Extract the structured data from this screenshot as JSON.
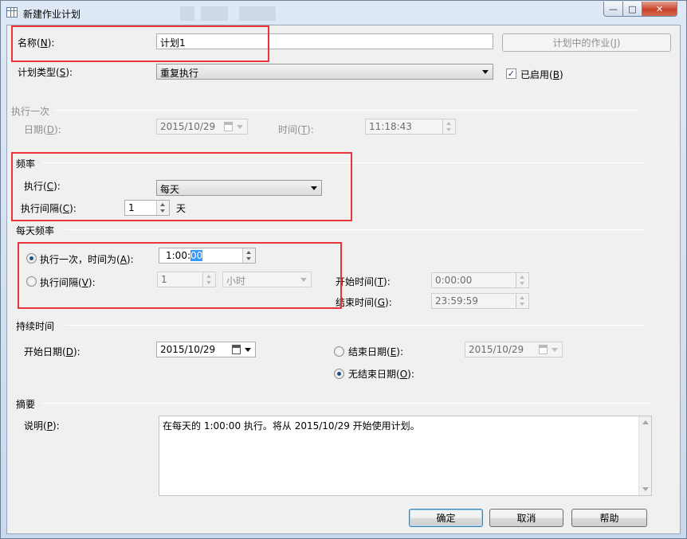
{
  "window": {
    "title": "新建作业计划"
  },
  "name_row": {
    "label": "名称",
    "accel": "N",
    "value": "计划1",
    "jobs_button": "计划中的作业",
    "jobs_accel": "J"
  },
  "type_row": {
    "label": "计划类型",
    "accel": "S",
    "value": "重复执行",
    "enabled_label": "已启用",
    "enabled_accel": "B",
    "enabled_checked": true
  },
  "once": {
    "section": "执行一次",
    "date_label": "日期",
    "date_accel": "D",
    "date_value": "2015/10/29",
    "time_label": "时间",
    "time_accel": "T",
    "time_value": "11:18:43"
  },
  "frequency": {
    "section": "频率",
    "run_label": "执行",
    "run_accel": "C",
    "run_value": "每天",
    "interval_label": "执行间隔",
    "interval_accel": "C",
    "interval_value": "1",
    "interval_unit": "天"
  },
  "daily": {
    "section": "每天频率",
    "once_label": "执行一次，时间为",
    "once_accel": "A",
    "once_time_pre": "1:00:",
    "once_time_sel": "00",
    "once_selected": true,
    "every_label": "执行间隔",
    "every_accel": "V",
    "every_value": "1",
    "every_unit": "小时",
    "start_label": "开始时间",
    "start_accel": "T",
    "start_value": "0:00:00",
    "end_label": "结束时间",
    "end_accel": "G",
    "end_value": "23:59:59"
  },
  "duration": {
    "section": "持续时间",
    "start_date_label": "开始日期",
    "start_date_accel": "D",
    "start_date_value": "2015/10/29",
    "end_date_label": "结束日期",
    "end_date_accel": "E",
    "end_date_value": "2015/10/29",
    "no_end_label": "无结束日期",
    "no_end_accel": "O",
    "no_end_selected": true
  },
  "summary": {
    "section": "摘要",
    "desc_label": "说明",
    "desc_accel": "P",
    "desc_value": "在每天的 1:00:00 执行。将从 2015/10/29 开始使用计划。"
  },
  "buttons": {
    "ok": "确定",
    "cancel": "取消",
    "help": "帮助"
  },
  "colors": {
    "highlight": "#e8343b",
    "selection": "#3399ff"
  }
}
